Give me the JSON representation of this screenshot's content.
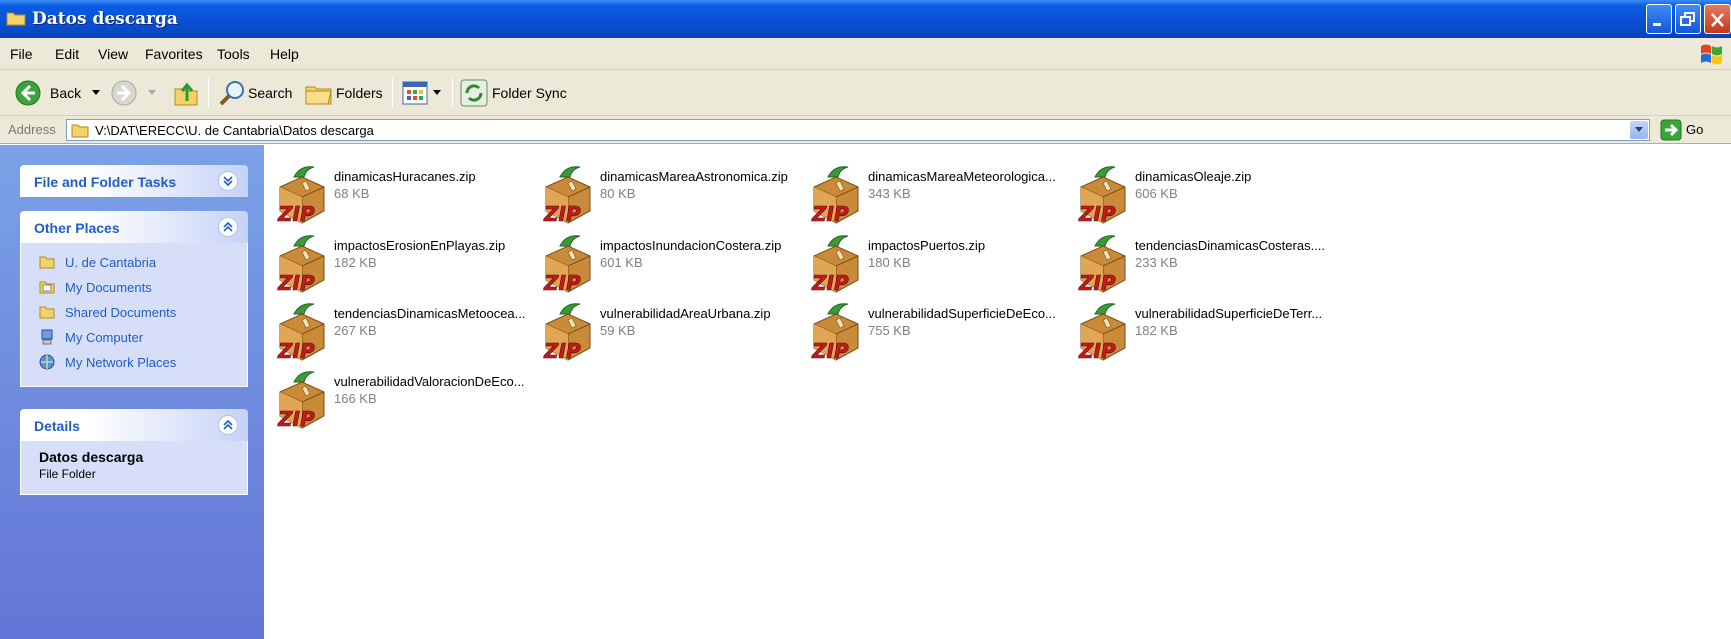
{
  "window": {
    "title": "Datos descarga"
  },
  "menu": [
    "File",
    "Edit",
    "View",
    "Favorites",
    "Tools",
    "Help"
  ],
  "toolbar": {
    "back": "Back",
    "search": "Search",
    "folders": "Folders",
    "folder_sync": "Folder Sync"
  },
  "address": {
    "label": "Address",
    "value": "V:\\DAT\\ERECC\\U. de Cantabria\\Datos descarga",
    "go": "Go"
  },
  "sidebar": {
    "file_tasks": {
      "title": "File and Folder Tasks"
    },
    "other_places": {
      "title": "Other Places",
      "items": [
        {
          "label": "U. de Cantabria",
          "icon": "folder-icon"
        },
        {
          "label": "My Documents",
          "icon": "my-documents-icon"
        },
        {
          "label": "Shared Documents",
          "icon": "folder-icon"
        },
        {
          "label": "My Computer",
          "icon": "computer-icon"
        },
        {
          "label": "My Network Places",
          "icon": "network-icon"
        }
      ]
    },
    "details": {
      "title": "Details",
      "name": "Datos descarga",
      "type": "File Folder"
    }
  },
  "files": [
    {
      "name": "dinamicasHuracanes.zip",
      "size": "68 KB"
    },
    {
      "name": "dinamicasMareaAstronomica.zip",
      "size": "80 KB"
    },
    {
      "name": "dinamicasMareaMeteorologica...",
      "size": "343 KB"
    },
    {
      "name": "dinamicasOleaje.zip",
      "size": "606 KB"
    },
    {
      "name": "impactosErosionEnPlayas.zip",
      "size": "182 KB"
    },
    {
      "name": "impactosInundacionCostera.zip",
      "size": "601 KB"
    },
    {
      "name": "impactosPuertos.zip",
      "size": "180 KB"
    },
    {
      "name": "tendenciasDinamicasCosteras....",
      "size": "233 KB"
    },
    {
      "name": "tendenciasDinamicasMetoocea...",
      "size": "267 KB"
    },
    {
      "name": "vulnerabilidadAreaUrbana.zip",
      "size": "59 KB"
    },
    {
      "name": "vulnerabilidadSuperficieDeEco...",
      "size": "755 KB"
    },
    {
      "name": "vulnerabilidadSuperficieDeTerr...",
      "size": "182 KB"
    },
    {
      "name": "vulnerabilidadValoracionDeEco...",
      "size": "166 KB"
    }
  ]
}
